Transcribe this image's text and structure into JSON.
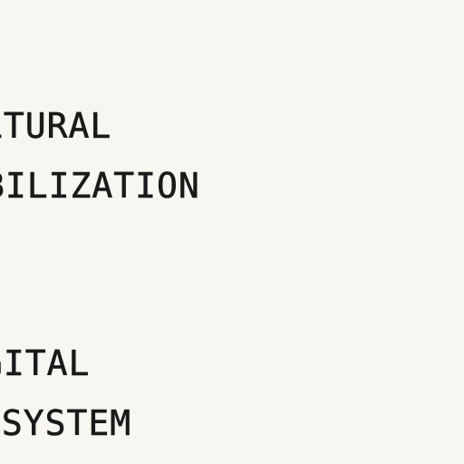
{
  "blocks": [
    {
      "lines": [
        "LTURAL",
        "BILIZATION"
      ]
    },
    {
      "lines": [
        "GITAL",
        "OSYSTEM"
      ]
    }
  ]
}
